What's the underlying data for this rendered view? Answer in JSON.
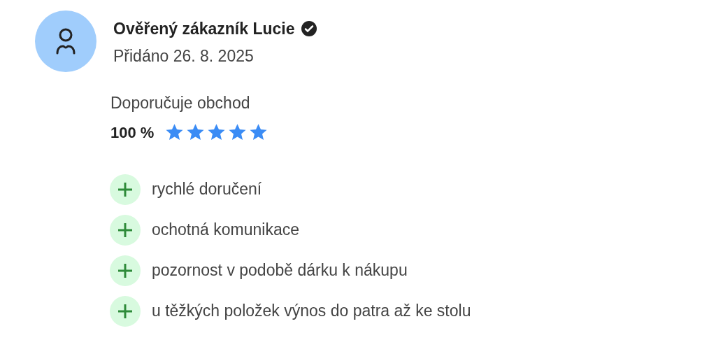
{
  "review": {
    "author": "Ověřený zákazník Lucie",
    "verified": true,
    "date": "Přidáno 26. 8. 2025",
    "recommend_label": "Doporučuje obchod",
    "recommend_value": "100 %",
    "stars": 5,
    "pros": [
      {
        "kind": "plus",
        "text": "rychlé doručení"
      },
      {
        "kind": "plus",
        "text": "ochotná komunikace"
      },
      {
        "kind": "plus",
        "text": "pozornost v podobě dárku k nákupu"
      },
      {
        "kind": "plus",
        "text": "u těžkých položek výnos do patra až ke stolu"
      }
    ]
  }
}
